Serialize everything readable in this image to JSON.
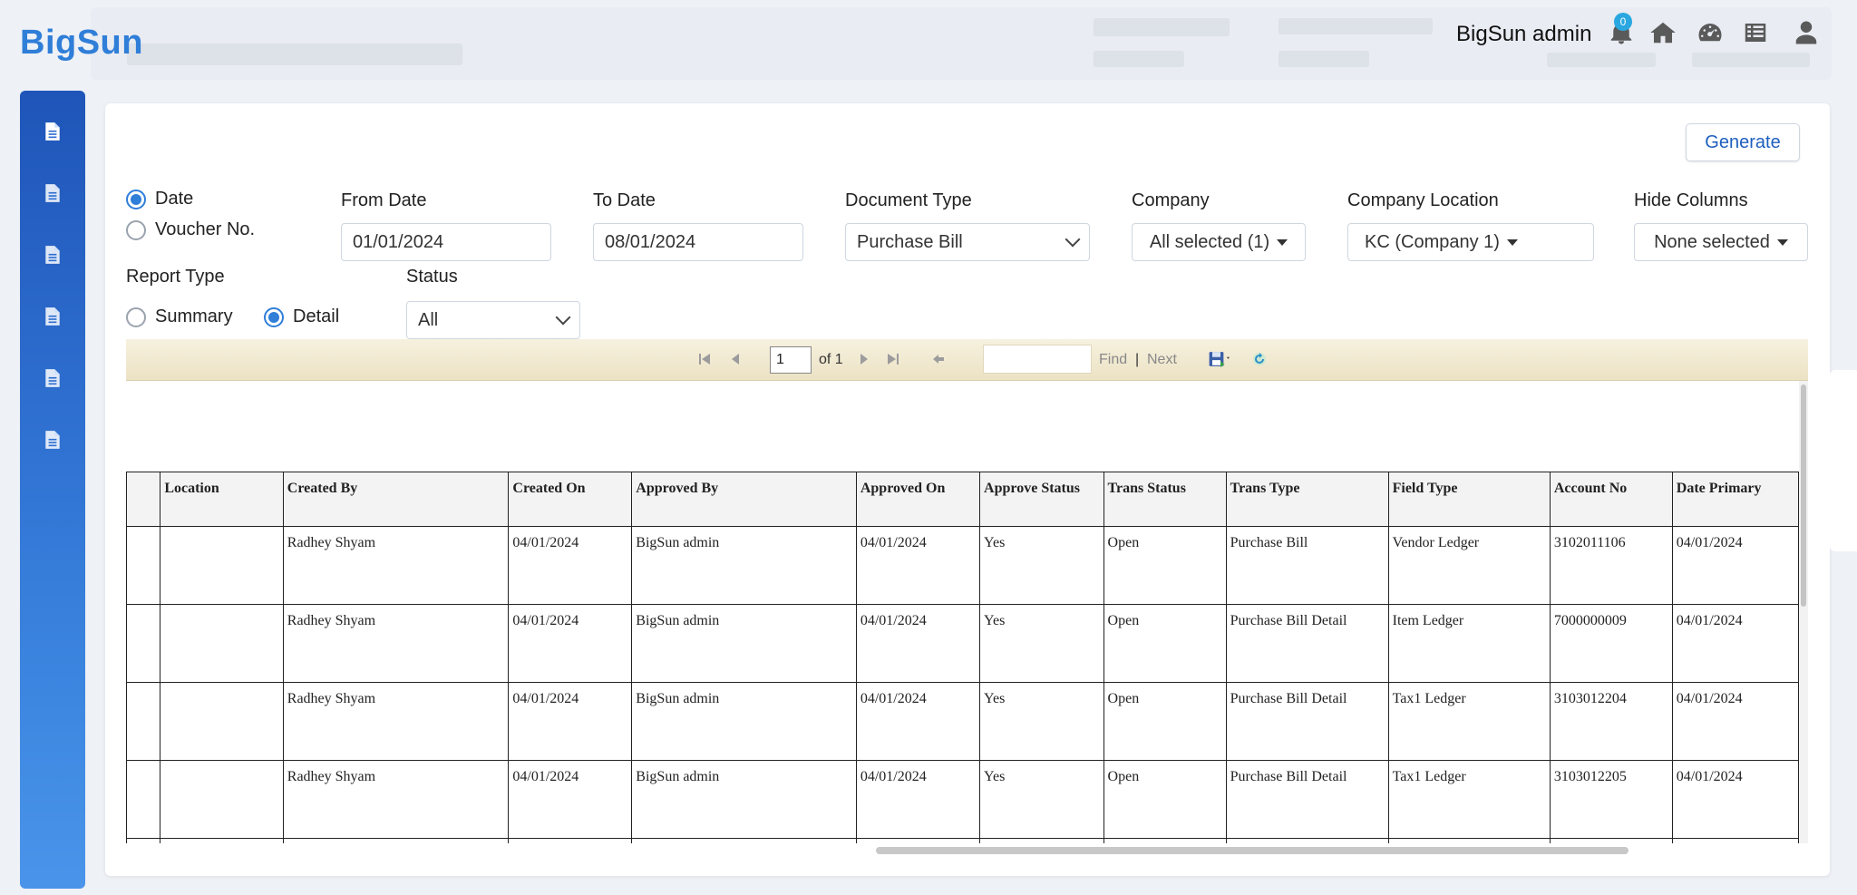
{
  "header": {
    "logo": "BigSun",
    "user_name": "BigSun admin",
    "notification_count": "0"
  },
  "sidebar": {
    "items": [
      "document-icon",
      "document-icon",
      "document-icon",
      "document-icon",
      "document-icon",
      "document-icon"
    ]
  },
  "form": {
    "generate_label": "Generate",
    "date_radio": "Date",
    "voucher_radio": "Voucher No.",
    "from_date_label": "From Date",
    "from_date_value": "01/01/2024",
    "to_date_label": "To Date",
    "to_date_value": "08/01/2024",
    "document_type_label": "Document Type",
    "document_type_value": "Purchase Bill",
    "company_label": "Company",
    "company_value": "All selected (1)",
    "company_location_label": "Company Location",
    "company_location_value": "KC (Company 1)",
    "hide_columns_label": "Hide Columns",
    "hide_columns_value": "None selected",
    "report_type_label": "Report Type",
    "summary_radio": "Summary",
    "detail_radio": "Detail",
    "status_label": "Status",
    "status_value": "All"
  },
  "report_toolbar": {
    "page_value": "1",
    "of_text": "of 1",
    "find_label": "Find",
    "separator": "|",
    "next_label": "Next"
  },
  "table": {
    "columns": [
      "",
      "Location",
      "Created By",
      "Created On",
      "Approved By",
      "Approved On",
      "Approve Status",
      "Trans Status",
      "Trans Type",
      "Field Type",
      "Account No",
      "Date Primary"
    ],
    "rows": [
      [
        "",
        "",
        "Radhey  Shyam",
        "04/01/2024",
        "BigSun  admin",
        "04/01/2024",
        "Yes",
        "Open",
        "Purchase Bill",
        "Vendor Ledger",
        "3102011106",
        "04/01/2024"
      ],
      [
        "",
        "",
        "Radhey  Shyam",
        "04/01/2024",
        "BigSun  admin",
        "04/01/2024",
        "Yes",
        "Open",
        "Purchase Bill Detail",
        "Item Ledger",
        "7000000009",
        "04/01/2024"
      ],
      [
        "",
        "",
        "Radhey  Shyam",
        "04/01/2024",
        "BigSun  admin",
        "04/01/2024",
        "Yes",
        "Open",
        "Purchase Bill Detail",
        "Tax1 Ledger",
        "3103012204",
        "04/01/2024"
      ],
      [
        "",
        "",
        "Radhey  Shyam",
        "04/01/2024",
        "BigSun  admin",
        "04/01/2024",
        "Yes",
        "Open",
        "Purchase Bill Detail",
        "Tax1 Ledger",
        "3103012205",
        "04/01/2024"
      ],
      [
        "",
        "",
        "",
        "",
        "",
        "",
        "",
        "",
        "",
        "",
        "",
        ""
      ]
    ]
  }
}
